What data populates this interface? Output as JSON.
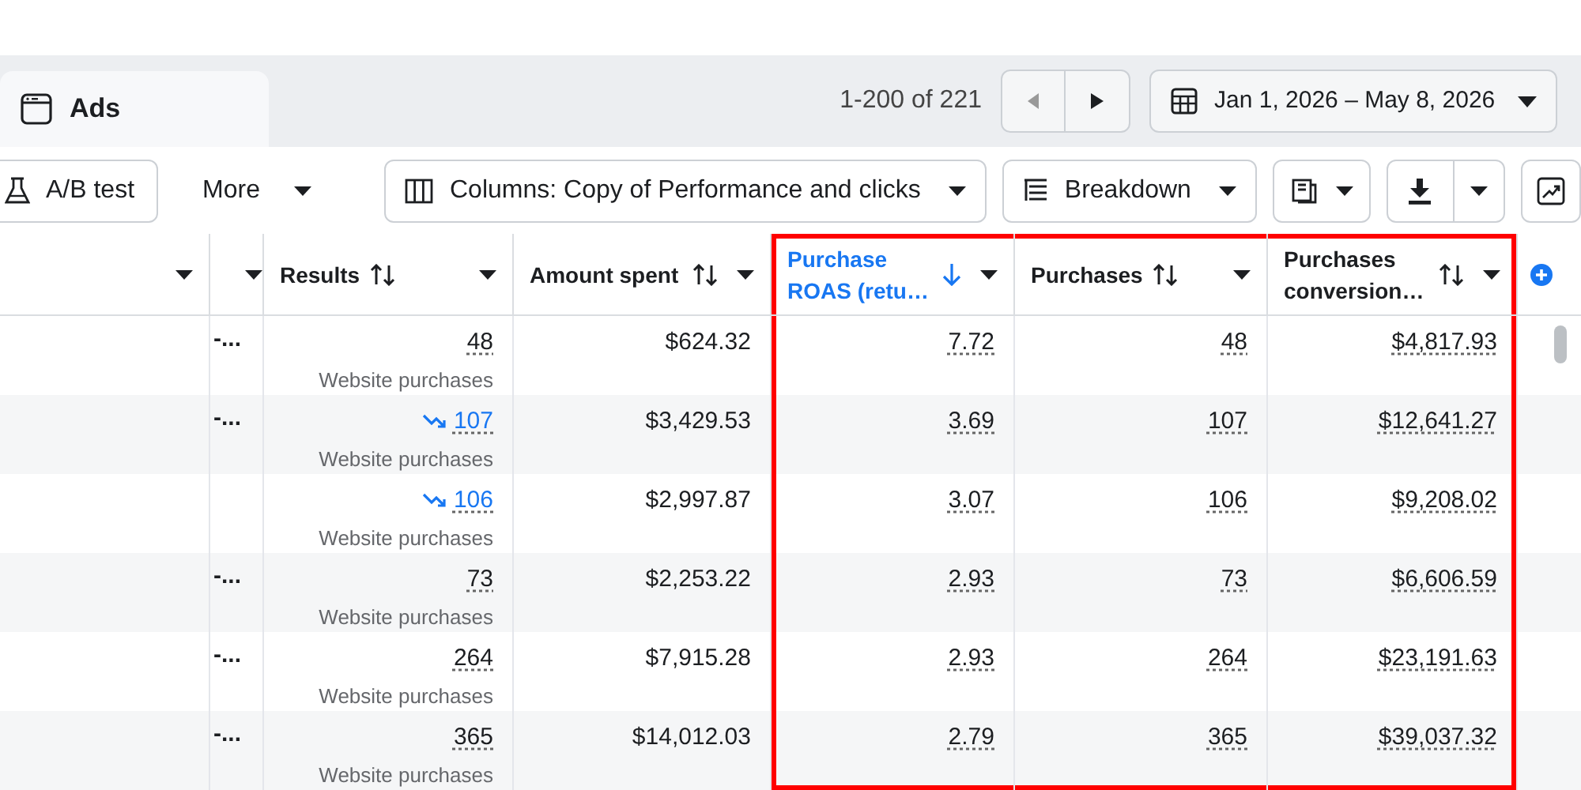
{
  "tab": {
    "label": "Ads"
  },
  "pager": {
    "range": "1-200 of 221"
  },
  "date_range": {
    "label": "Jan 1, 2026 – May 8, 2026"
  },
  "toolbar": [
    {
      "kind": "button",
      "label": "A/B test"
    },
    {
      "kind": "menu",
      "label": "More"
    },
    {
      "kind": "dropdown",
      "label": "Columns: Copy of Performance and clicks"
    },
    {
      "kind": "dropdown",
      "label": "Breakdown"
    }
  ],
  "table": {
    "columns": [
      {
        "sorted": false,
        "highlighted": false
      },
      {
        "sorted": false,
        "highlighted": false
      },
      {
        "label": "Results",
        "sorted": false,
        "highlighted": false
      },
      {
        "label": "Amount spent",
        "sorted": false,
        "highlighted": false
      },
      {
        "label": "Purchase ROAS (retu…",
        "sorted": true,
        "highlighted": true
      },
      {
        "label": "Purchases",
        "sorted": false,
        "highlighted": true
      },
      {
        "label": "Purchases conversion…",
        "sorted": false,
        "highlighted": true
      }
    ],
    "rows": [
      {
        "column_2": "-...",
        "results": "48",
        "trend_down": false,
        "result_type": "Website purchases",
        "amount_spent": "$624.32",
        "roas": "7.72",
        "purchases": "48",
        "conversion_value": "$4,817.93"
      },
      {
        "column_2": "-...",
        "results": "107",
        "trend_down": true,
        "result_type": "Website purchases",
        "amount_spent": "$3,429.53",
        "roas": "3.69",
        "purchases": "107",
        "conversion_value": "$12,641.27"
      },
      {
        "results": "106",
        "trend_down": true,
        "result_type": "Website purchases",
        "amount_spent": "$2,997.87",
        "roas": "3.07",
        "purchases": "106",
        "conversion_value": "$9,208.02"
      },
      {
        "column_2": "-...",
        "results": "73",
        "trend_down": false,
        "result_type": "Website purchases",
        "amount_spent": "$2,253.22",
        "roas": "2.93",
        "purchases": "73",
        "conversion_value": "$6,606.59"
      },
      {
        "column_2": "-...",
        "results": "264",
        "trend_down": false,
        "result_type": "Website purchases",
        "amount_spent": "$7,915.28",
        "roas": "2.93",
        "purchases": "264",
        "conversion_value": "$23,191.63"
      },
      {
        "column_2": "-...",
        "results": "365",
        "trend_down": false,
        "result_type": "Website purchases",
        "amount_spent": "$14,012.03",
        "roas": "2.79",
        "purchases": "365",
        "conversion_value": "$39,037.32"
      }
    ]
  }
}
